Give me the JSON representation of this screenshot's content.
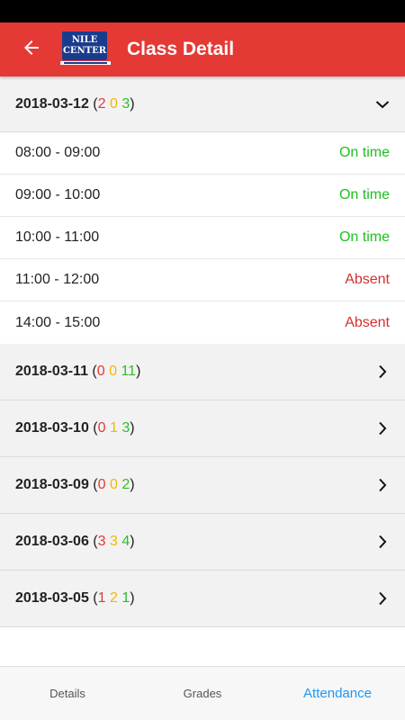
{
  "header": {
    "title": "Class Detail",
    "logo_text": "NILE CENTER"
  },
  "colors": {
    "app_bar": "#e53935",
    "late": "#e53935",
    "excused": "#f2b705",
    "present": "#2ebd2e",
    "on_time": "#1fbf1f",
    "absent": "#d32f2f",
    "active_tab": "#2196f3"
  },
  "days": [
    {
      "date": "2018-03-12",
      "counts": [
        "2",
        "0",
        "3"
      ],
      "expanded": true,
      "icon": "chevron-down-icon",
      "slots": [
        {
          "time": "08:00 - 09:00",
          "status": "On time"
        },
        {
          "time": "09:00 - 10:00",
          "status": "On time"
        },
        {
          "time": "10:00 - 11:00",
          "status": "On time"
        },
        {
          "time": "11:00 - 12:00",
          "status": "Absent"
        },
        {
          "time": "14:00 - 15:00",
          "status": "Absent"
        }
      ]
    },
    {
      "date": "2018-03-11",
      "counts": [
        "0",
        "0",
        "11"
      ],
      "expanded": false,
      "icon": "chevron-right-icon"
    },
    {
      "date": "2018-03-10",
      "counts": [
        "0",
        "1",
        "3"
      ],
      "expanded": false,
      "icon": "chevron-right-icon"
    },
    {
      "date": "2018-03-09",
      "counts": [
        "0",
        "0",
        "2"
      ],
      "expanded": false,
      "icon": "chevron-right-icon"
    },
    {
      "date": "2018-03-06",
      "counts": [
        "3",
        "3",
        "4"
      ],
      "expanded": false,
      "icon": "chevron-right-icon"
    },
    {
      "date": "2018-03-05",
      "counts": [
        "1",
        "2",
        "1"
      ],
      "expanded": false,
      "icon": "chevron-right-icon"
    }
  ],
  "bottom_nav": {
    "tabs": [
      {
        "label": "Details",
        "active": false
      },
      {
        "label": "Grades",
        "active": false
      },
      {
        "label": "Attendance",
        "active": true
      }
    ]
  }
}
